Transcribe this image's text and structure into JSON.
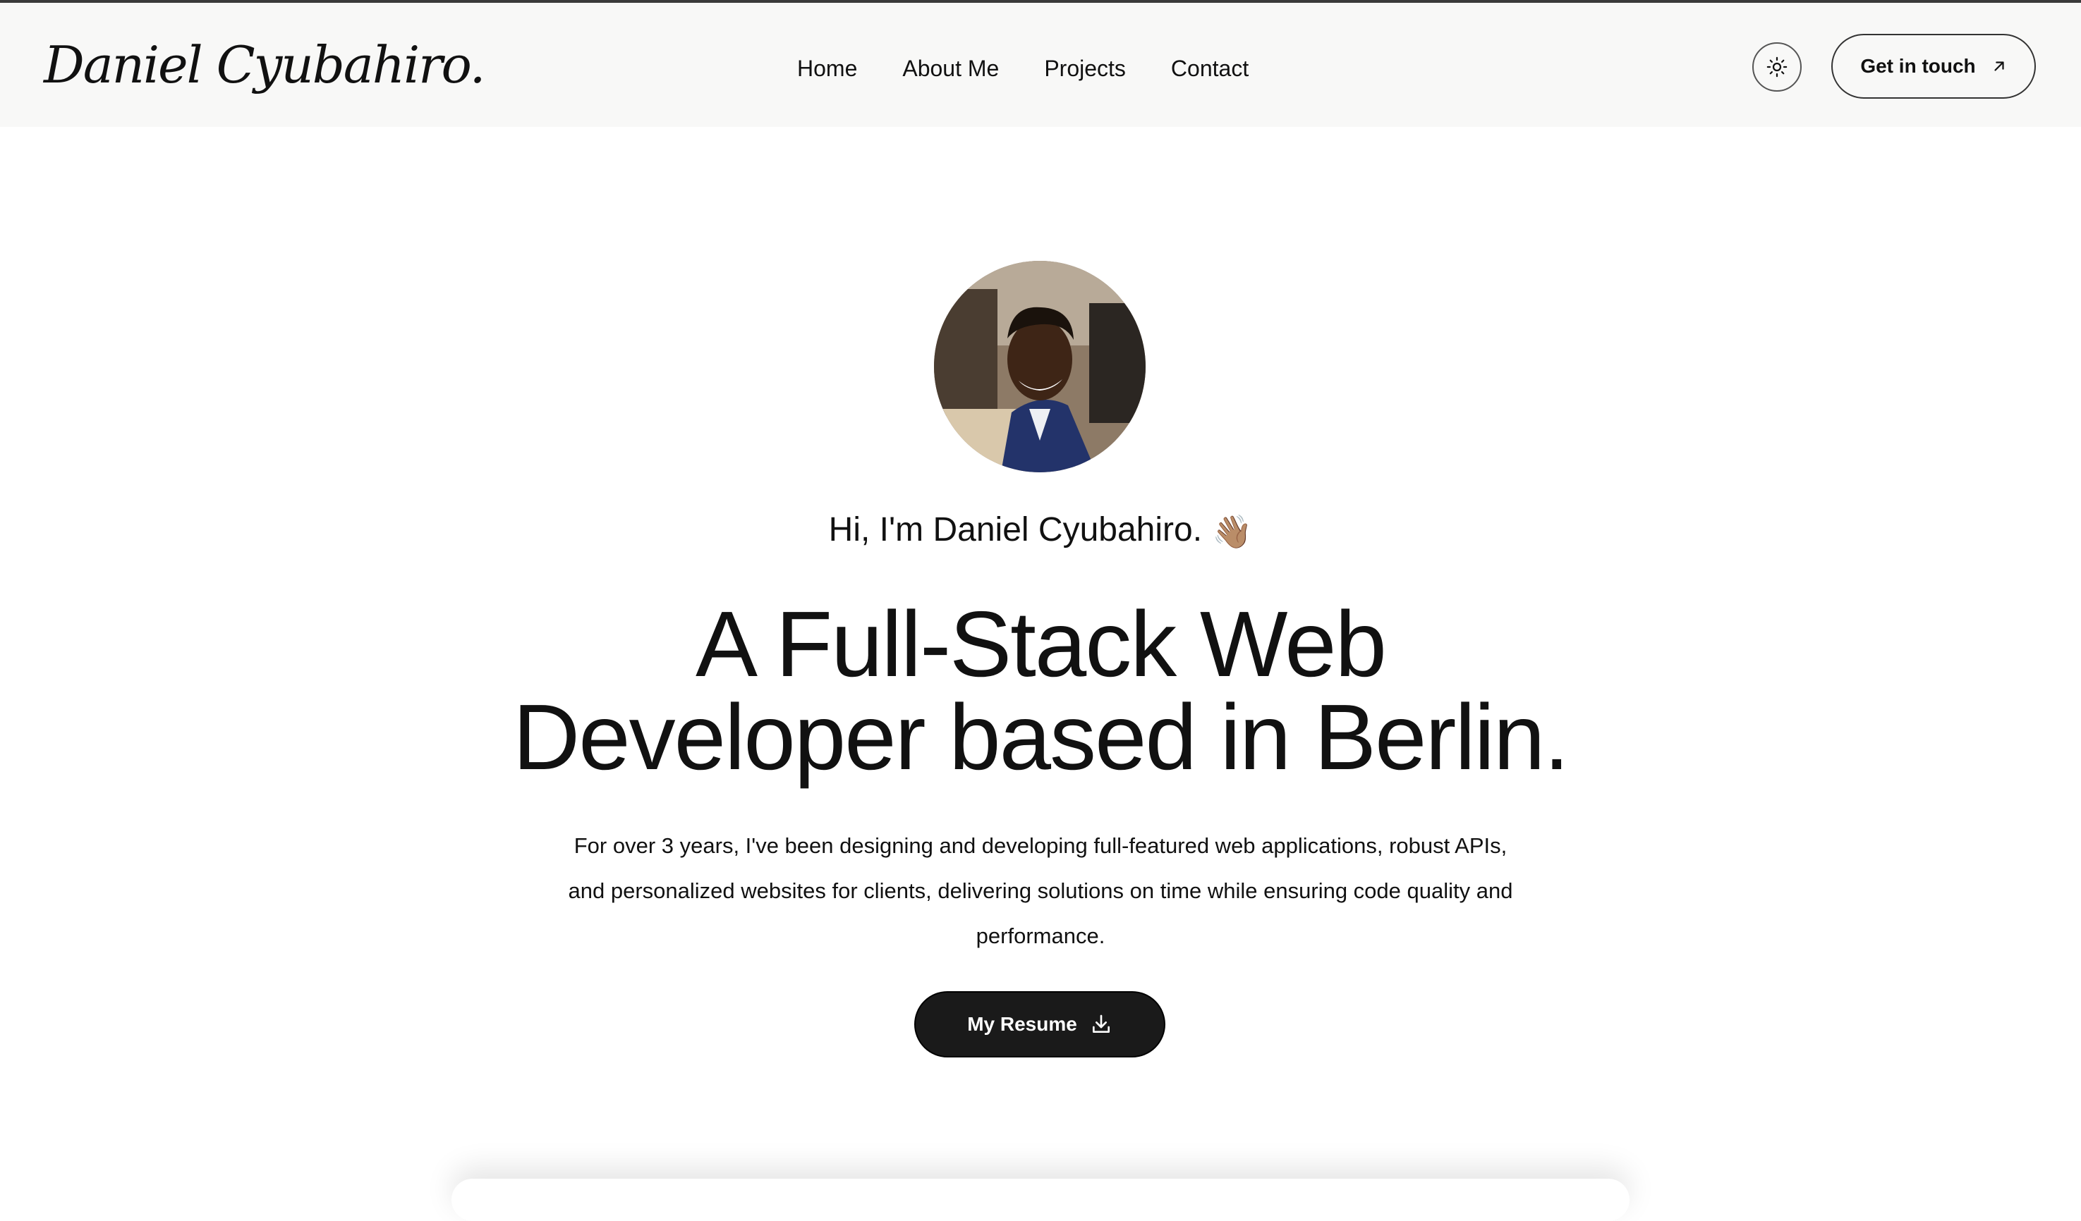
{
  "header": {
    "logo_text": "Daniel Cyubahiro.",
    "nav": [
      {
        "label": "Home"
      },
      {
        "label": "About Me"
      },
      {
        "label": "Projects"
      },
      {
        "label": "Contact"
      }
    ],
    "theme_toggle_icon": "sun-icon",
    "cta_label": "Get in touch",
    "cta_icon": "arrow-up-right-icon"
  },
  "hero": {
    "greeting": "Hi, I'm Daniel Cyubahiro.",
    "greeting_emoji": "👋🏽",
    "headline_line1": "A Full-Stack Web",
    "headline_line2": "Developer based in Berlin.",
    "intro": "For over 3 years, I've been designing and developing full-featured web applications, robust APIs, and personalized websites for clients, delivering solutions on time while ensuring code quality and performance.",
    "resume_label": "My Resume",
    "resume_icon": "download-icon"
  },
  "colors": {
    "header_bg": "#f8f8f7",
    "text": "#111111",
    "button_dark": "#1a1a1a",
    "page_bg": "#ffffff"
  }
}
